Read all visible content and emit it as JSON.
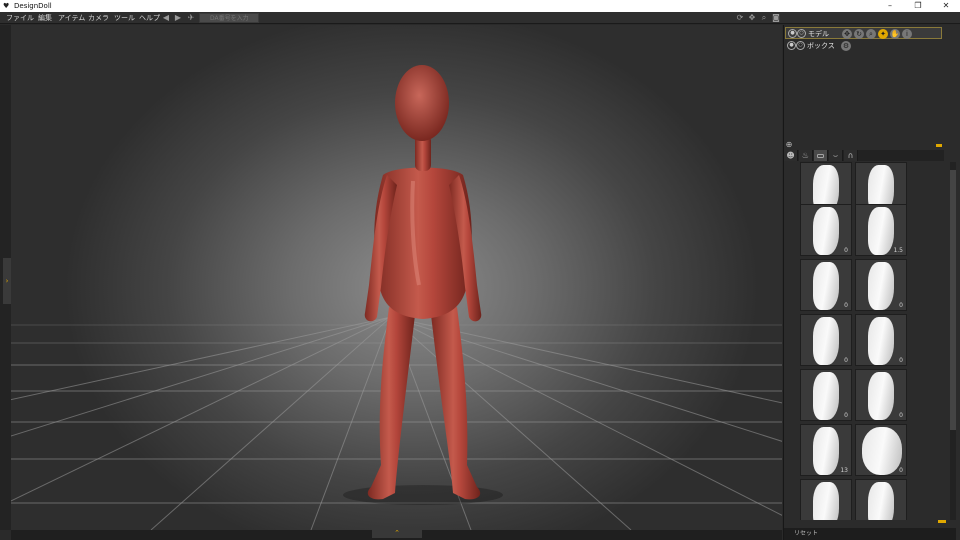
{
  "window": {
    "title": "DesignDoll",
    "controls": [
      "–",
      "❐",
      "✕"
    ]
  },
  "menubar": {
    "items": [
      "ファイル",
      "編集",
      "アイテム",
      "カメラ",
      "ツール",
      "ヘルプ"
    ],
    "search_placeholder": "DA番号を入力"
  },
  "layers": {
    "items": [
      {
        "label": "モデル",
        "selected": true
      },
      {
        "label": "ボックス",
        "selected": false
      }
    ]
  },
  "thumbnails": {
    "values": [
      "0",
      "0",
      "0",
      "1.5",
      "0",
      "0",
      "0",
      "0",
      "0",
      "0",
      "13",
      "0",
      "",
      ""
    ]
  },
  "statusbar": {
    "text": "リセット"
  },
  "colors": {
    "accent": "#e0a800",
    "figure": "#b5473c",
    "viewport_center": "#8d8d8d",
    "panel": "#2b2b2b"
  },
  "icons": {
    "app": "doll-icon",
    "left_tab": "chevron-right-icon",
    "bottom_tab": "chevron-up-icon"
  }
}
